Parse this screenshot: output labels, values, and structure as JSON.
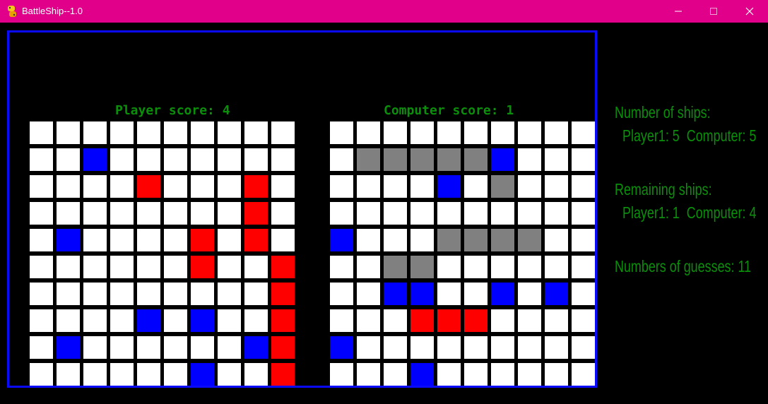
{
  "window": {
    "title": "BattleShip--1.0",
    "colors": {
      "titlebar": "#e1008a",
      "frame": "#0a0aff",
      "text": "#0a8f0a"
    }
  },
  "player_board": {
    "title": "Player score: 4",
    "rows": [
      "..........",
      "..M.......",
      "....H...H.",
      "........H.",
      ".M....H.H.",
      "......H..H",
      ".........H",
      "....M.M..H",
      ".M......MH",
      "......M..H"
    ]
  },
  "computer_board": {
    "title": "Computer score: 1",
    "rows": [
      "..........",
      ".SSSSSM...",
      "....M.S...",
      "..........",
      "M...SSSS..",
      "..SS......",
      "..MM..M.M.",
      "...HHH....",
      "M.........",
      "...M......"
    ]
  },
  "legend": {
    "H": "hit",
    "M": "miss",
    "S": "ship",
    ".": "empty"
  },
  "info": {
    "ships_label": "Number of ships:",
    "ships_value": "Player1: 5  Computer: 5",
    "remaining_label": "Remaining ships:",
    "remaining_value": "Player1: 1  Computer: 4",
    "guesses_label": "Numbers of guesses: 11"
  }
}
